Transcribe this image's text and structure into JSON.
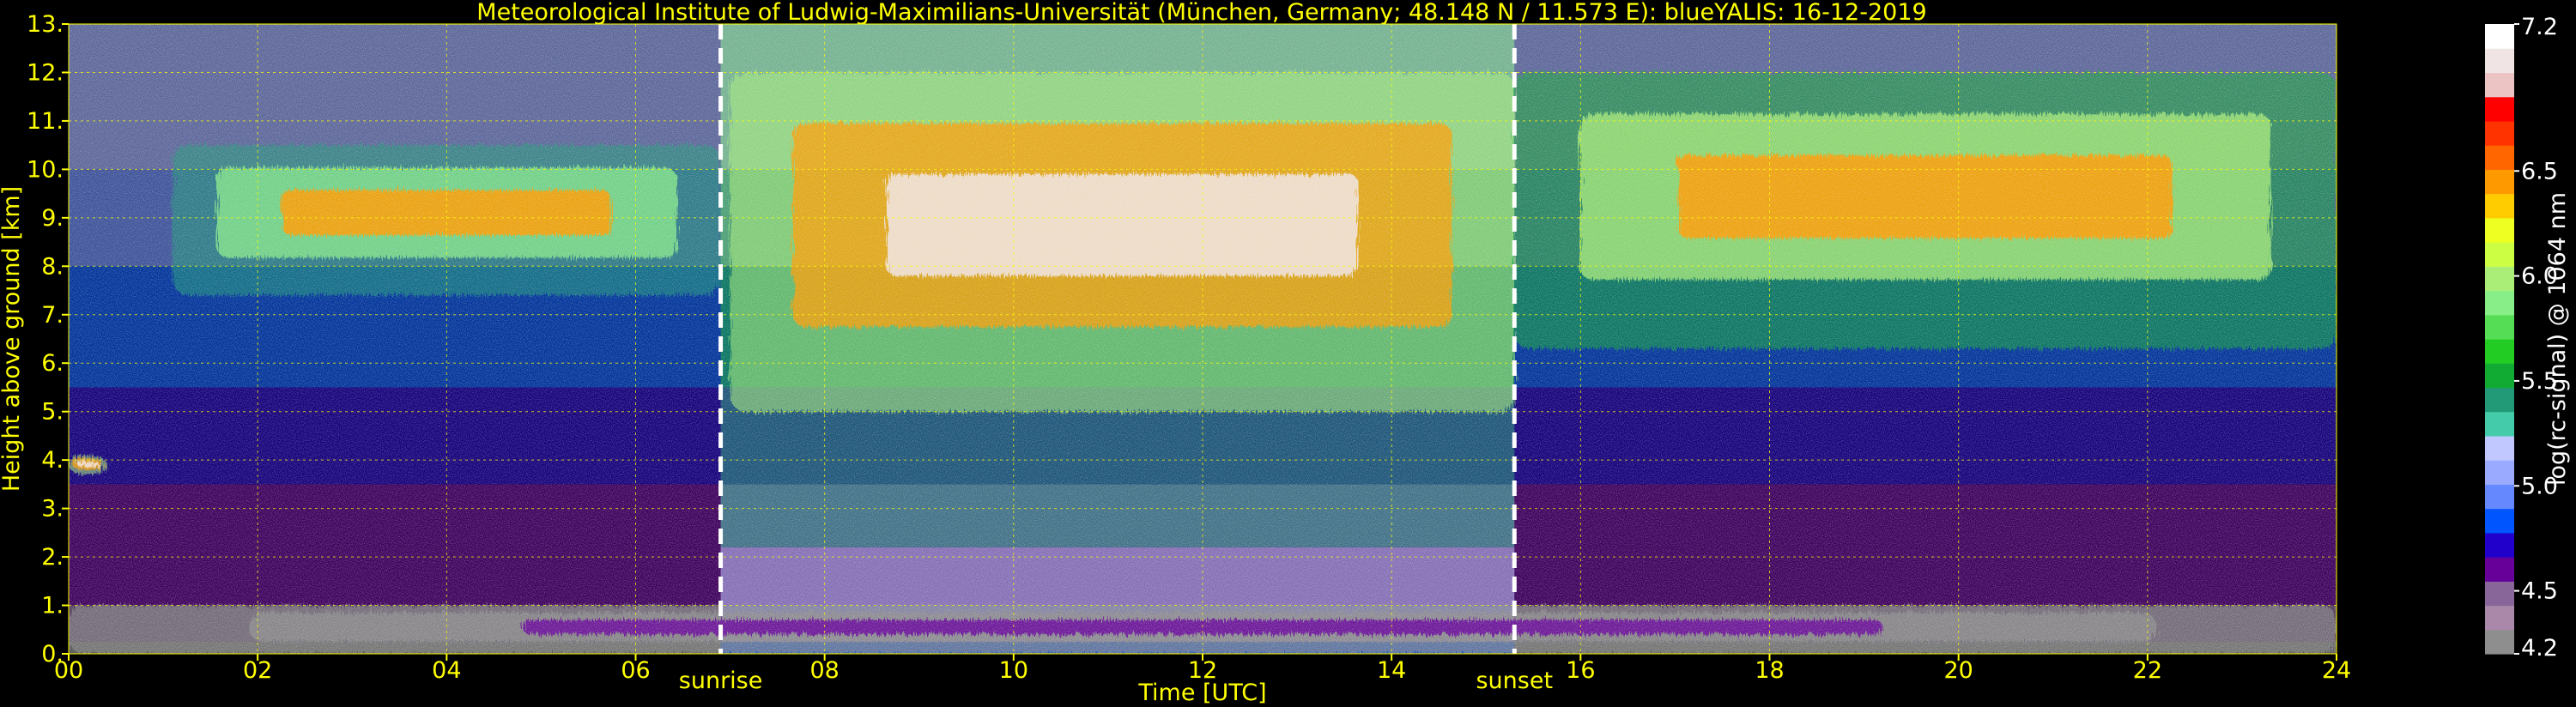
{
  "chart_data": {
    "type": "heatmap",
    "title": "Meteorological Institute of Ludwig-Maximilians-Universität (München, Germany; 48.148 N / 11.573 E):    blueYALIS: 16-12-2019",
    "xlabel": "Time [UTC]",
    "ylabel": "Height above ground [km]",
    "xlim": [
      0,
      24
    ],
    "ylim": [
      0,
      13
    ],
    "x_ticks": [
      "00",
      "02",
      "04",
      "06",
      "08",
      "10",
      "12",
      "14",
      "16",
      "18",
      "20",
      "22",
      "24"
    ],
    "y_ticks": [
      "0.",
      "1.",
      "2.",
      "3.",
      "4.",
      "5.",
      "6.",
      "7.",
      "8.",
      "9.",
      "10.",
      "11.",
      "12.",
      "13."
    ],
    "grid": true,
    "markers": [
      {
        "label": "sunrise",
        "x": 6.9
      },
      {
        "label": "sunset",
        "x": 15.3
      }
    ],
    "colorbar": {
      "label": "log(rc-signal) @ 1064 nm",
      "range": [
        4.2,
        7.2
      ],
      "ticks": [
        "4.2",
        "4.5",
        "5.0",
        "5.5",
        "6.0",
        "6.5",
        "7.2"
      ],
      "colors": [
        "#8e8e8e",
        "#aa88aa",
        "#886699",
        "#660099",
        "#2200cc",
        "#0055ff",
        "#6688ff",
        "#99aaff",
        "#c0c8ff",
        "#44ccaa",
        "#229977",
        "#11aa33",
        "#22cc22",
        "#55dd55",
        "#88ee88",
        "#aaee77",
        "#ccff44",
        "#eeff22",
        "#ffcc00",
        "#ff9900",
        "#ff6600",
        "#ff3300",
        "#ff0000",
        "#ecc4c4",
        "#f0e4e4",
        "#ffffff"
      ]
    },
    "features": [
      {
        "name": "cirrus cloud (night, early)",
        "x": [
          1.1,
          6.9
        ],
        "y": [
          7.4,
          10.5
        ],
        "level": 6.4
      },
      {
        "name": "cirrus cloud (daytime, white fall streaks)",
        "x": [
          7.0,
          15.3
        ],
        "y": [
          5.0,
          12.0
        ],
        "level": 7.0
      },
      {
        "name": "cirrus cloud (night, late)",
        "x": [
          15.3,
          24.0
        ],
        "y": [
          6.3,
          12.0
        ],
        "level": 6.5
      },
      {
        "name": "boundary layer",
        "x": [
          0,
          24
        ],
        "y": [
          0,
          1.0
        ],
        "level": 4.6
      },
      {
        "name": "low cloud",
        "x": [
          0.0,
          0.4
        ],
        "y": [
          3.7,
          4.1
        ],
        "level": 7.0
      }
    ]
  }
}
